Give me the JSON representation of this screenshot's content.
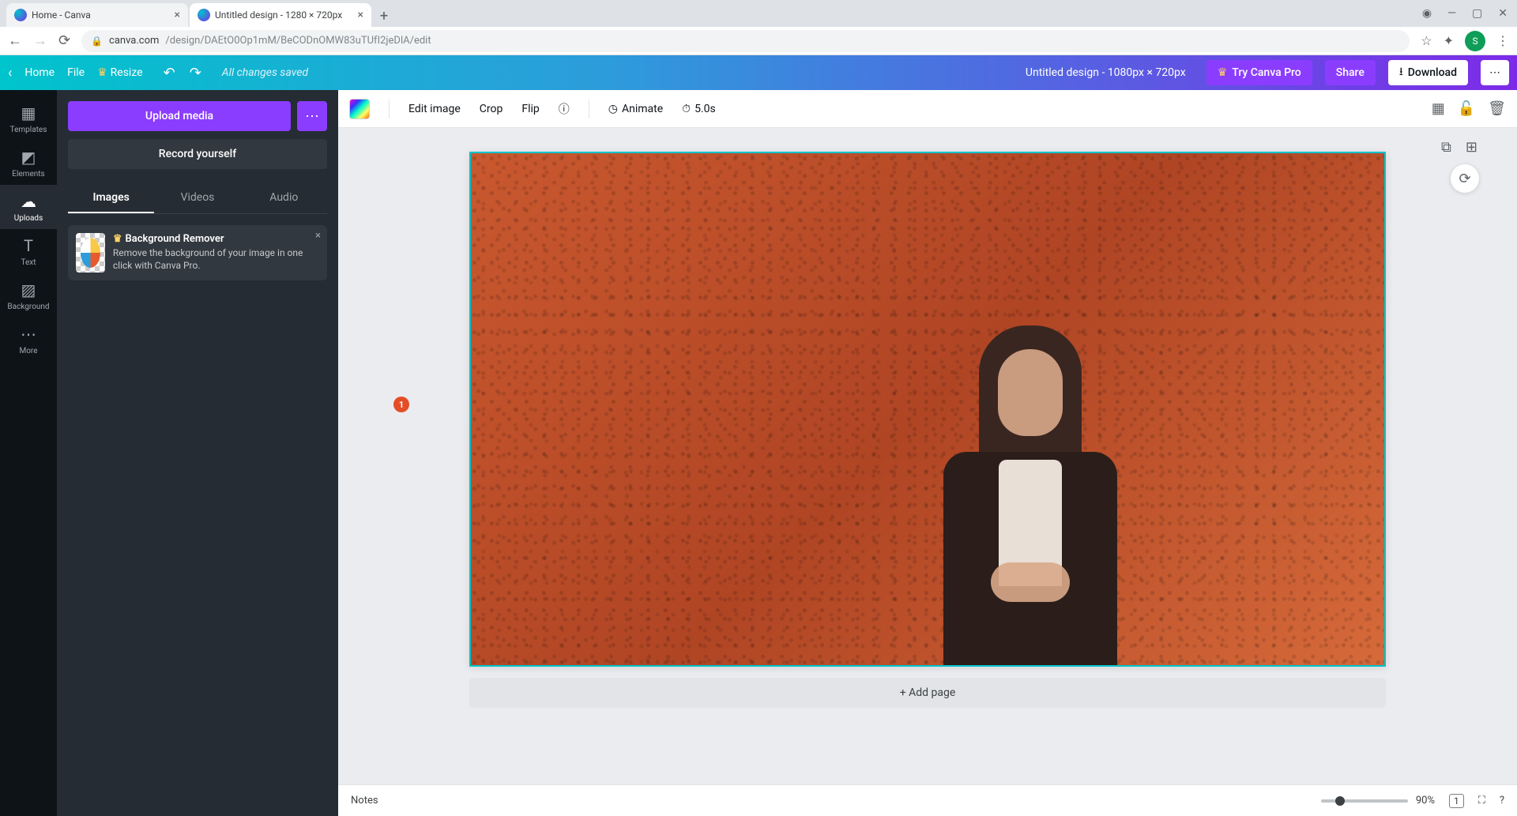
{
  "browser": {
    "tabs": [
      {
        "title": "Home - Canva"
      },
      {
        "title": "Untitled design - 1280 × 720px"
      }
    ],
    "url_host": "canva.com",
    "url_path": "/design/DAEtO0Op1mM/BeCODnOMW83uTUfI2jeDlA/edit",
    "avatar_letter": "S"
  },
  "topbar": {
    "home": "Home",
    "file": "File",
    "resize": "Resize",
    "saved": "All changes saved",
    "doc_title": "Untitled design - 1080px × 720px",
    "try_pro": "Try Canva Pro",
    "share": "Share",
    "download": "Download"
  },
  "rail": {
    "templates": "Templates",
    "elements": "Elements",
    "uploads": "Uploads",
    "text": "Text",
    "background": "Background",
    "more": "More"
  },
  "panel": {
    "upload": "Upload media",
    "record": "Record yourself",
    "tabs": {
      "images": "Images",
      "videos": "Videos",
      "audio": "Audio"
    },
    "promo_title": "Background Remover",
    "promo_desc": "Remove the background of your image in one click with Canva Pro."
  },
  "editbar": {
    "edit_image": "Edit image",
    "crop": "Crop",
    "flip": "Flip",
    "animate": "Animate",
    "timing": "5.0s"
  },
  "canvas": {
    "add_page": "+ Add page"
  },
  "bottombar": {
    "notes": "Notes",
    "zoom": "90%",
    "page_indicator": "1"
  },
  "annotation": {
    "badge": "1"
  }
}
